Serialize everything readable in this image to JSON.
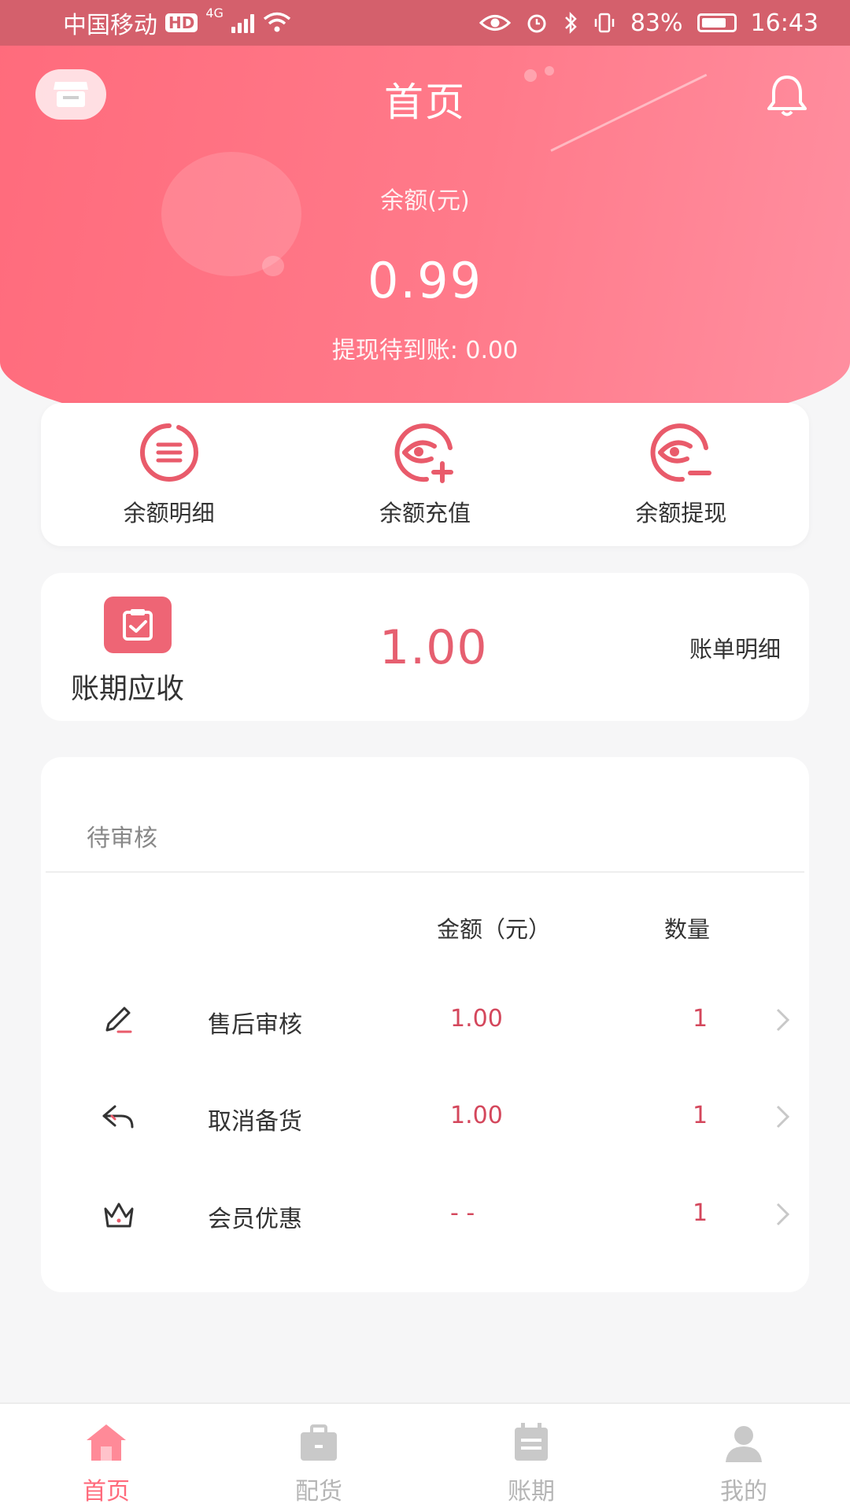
{
  "status_bar": {
    "carrier": "中国移动",
    "hd": "HD",
    "network": "4G",
    "battery": "83%",
    "time": "16:43"
  },
  "header": {
    "title": "首页",
    "balance_label": "余额(元)",
    "balance_value": "0.99",
    "pending_label": "提现待到账:",
    "pending_value": "0.00"
  },
  "actions": [
    {
      "label": "余额明细",
      "icon": "list-icon"
    },
    {
      "label": "余额充值",
      "icon": "eye-plus-icon"
    },
    {
      "label": "余额提现",
      "icon": "eye-minus-icon"
    }
  ],
  "billing": {
    "title": "账期应收",
    "amount": "1.00",
    "link": "账单明细"
  },
  "review": {
    "title": "待审核",
    "col_amount": "金额（元）",
    "col_qty": "数量",
    "rows": [
      {
        "name": "售后审核",
        "amount": "1.00",
        "qty": "1",
        "icon": "pencil-icon"
      },
      {
        "name": "取消备货",
        "amount": "1.00",
        "qty": "1",
        "icon": "undo-icon"
      },
      {
        "name": "会员优惠",
        "amount": "- -",
        "qty": "1",
        "icon": "crown-icon"
      }
    ]
  },
  "tabs": [
    {
      "label": "首页",
      "icon": "home-icon",
      "active": true
    },
    {
      "label": "配货",
      "icon": "briefcase-icon",
      "active": false
    },
    {
      "label": "账期",
      "icon": "calendar-icon",
      "active": false
    },
    {
      "label": "我的",
      "icon": "user-icon",
      "active": false
    }
  ],
  "colors": {
    "accent": "#ff6b7c",
    "amount_red": "#d4475c",
    "status_bar": "#d4606c"
  }
}
